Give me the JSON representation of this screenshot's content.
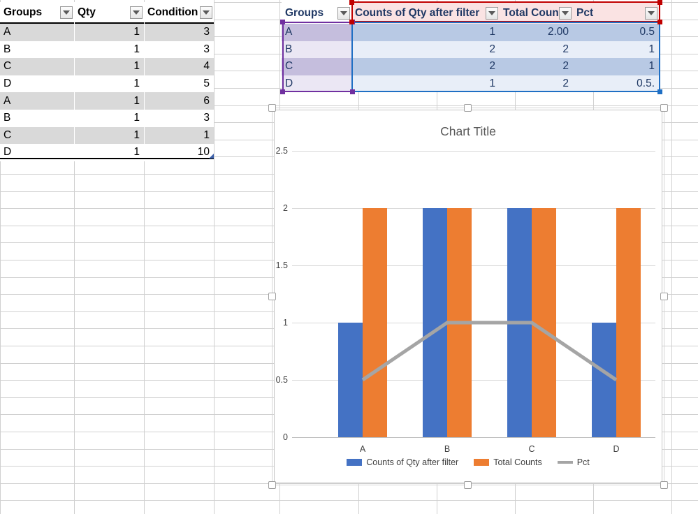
{
  "app": {
    "kind": "spreadsheet"
  },
  "left_table": {
    "name": "source-data-table",
    "headers": [
      "Groups",
      "Qty",
      "Condition"
    ],
    "filter_icon": "filter-dropdown-icon",
    "rows": [
      {
        "group": "A",
        "qty": "1",
        "condition": "3"
      },
      {
        "group": "B",
        "qty": "1",
        "condition": "3"
      },
      {
        "group": "C",
        "qty": "1",
        "condition": "4"
      },
      {
        "group": "D",
        "qty": "1",
        "condition": "5"
      },
      {
        "group": "A",
        "qty": "1",
        "condition": "6"
      },
      {
        "group": "B",
        "qty": "1",
        "condition": "3"
      },
      {
        "group": "C",
        "qty": "1",
        "condition": "1"
      },
      {
        "group": "D",
        "qty": "1",
        "condition": "10"
      }
    ]
  },
  "right_table": {
    "name": "summary-table",
    "headers": [
      "Groups",
      "Counts of Qty after filter",
      "Total Counts",
      "Pct"
    ],
    "filter_icon": "filter-dropdown-icon",
    "rows": [
      {
        "group": "A",
        "counts": "1",
        "total": "2.00",
        "pct": "0.5"
      },
      {
        "group": "B",
        "counts": "2",
        "total": "2",
        "pct": "1"
      },
      {
        "group": "C",
        "counts": "2",
        "total": "2",
        "pct": "1"
      },
      {
        "group": "D",
        "counts": "1",
        "total": "2",
        "pct": "0.5."
      }
    ],
    "selection": {
      "groups_range_color": "#7030a0",
      "header_range_color": "#c00000",
      "data_range_color": "#1f6fc4"
    }
  },
  "chart": {
    "title": "Chart Title",
    "selected": true
  },
  "chart_data": {
    "type": "bar",
    "title": "Chart Title",
    "xlabel": "",
    "ylabel": "",
    "ylim": [
      0,
      2.5
    ],
    "yticks": [
      "0",
      "0.5",
      "1",
      "1.5",
      "2",
      "2.5"
    ],
    "ytick_values": [
      0,
      0.5,
      1,
      1.5,
      2,
      2.5
    ],
    "grid": true,
    "legend_position": "bottom",
    "categories": [
      "A",
      "B",
      "C",
      "D"
    ],
    "series": [
      {
        "name": "Counts of Qty after filter",
        "type": "bar",
        "color": "#4472c4",
        "values": [
          1,
          2,
          2,
          1
        ]
      },
      {
        "name": "Total Counts",
        "type": "bar",
        "color": "#ed7d31",
        "values": [
          2,
          2,
          2,
          2
        ]
      },
      {
        "name": "Pct",
        "type": "line",
        "color": "#a5a5a5",
        "values": [
          0.5,
          1,
          1,
          0.5
        ]
      }
    ]
  }
}
